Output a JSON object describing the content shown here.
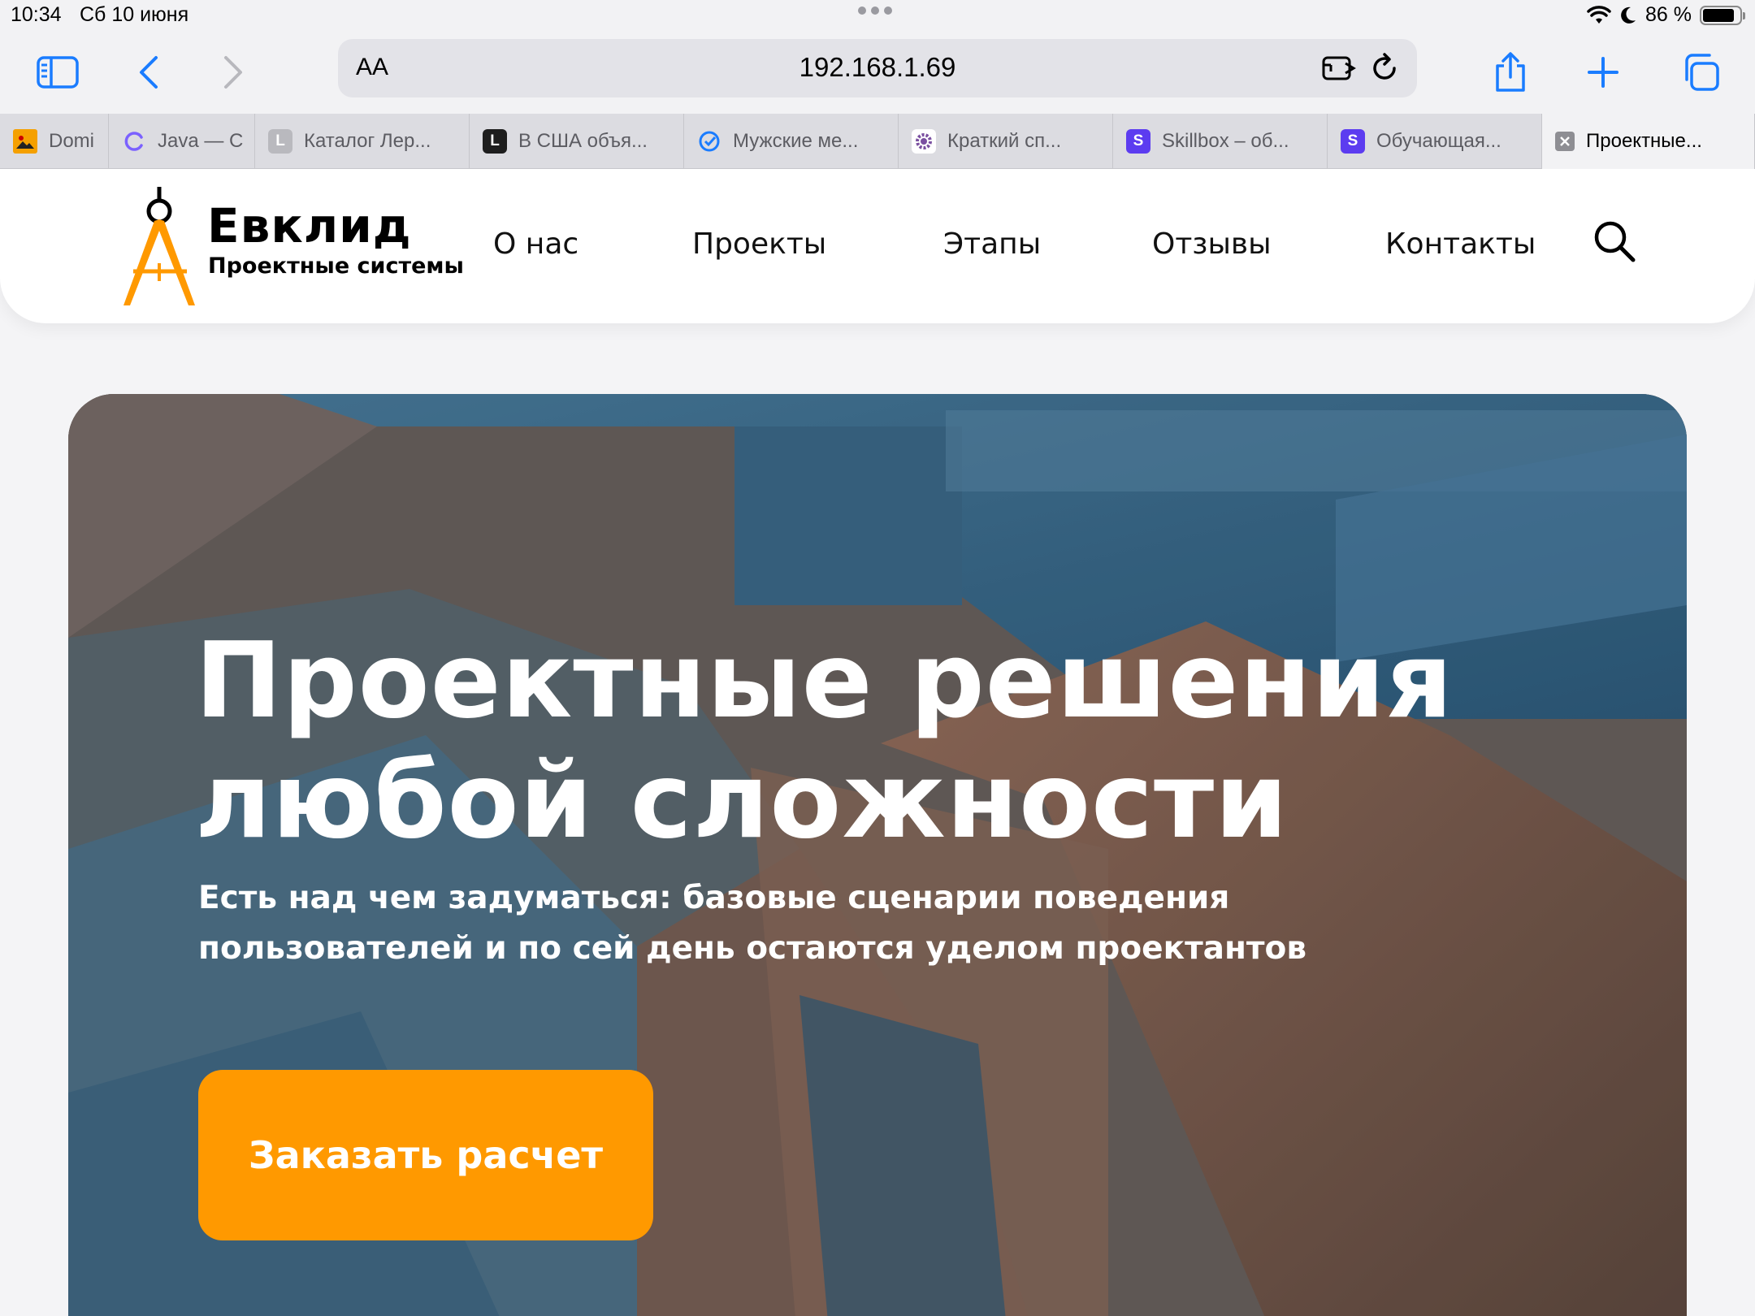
{
  "status_bar": {
    "time": "10:34",
    "date": "Сб 10 июня",
    "battery": "86 %",
    "battery_level": 0.86
  },
  "browser": {
    "text_size_label": "AA",
    "url": "192.168.1.69",
    "tabs": [
      {
        "title": "Domi",
        "favicon": "image-icon",
        "color": "#f5a000"
      },
      {
        "title": "Java — C",
        "favicon": "spinner-icon",
        "color": "#7b61ff"
      },
      {
        "title": "Каталог Лер...",
        "favicon": "L",
        "color": "#b9b9be"
      },
      {
        "title": "В США объя...",
        "favicon": "L",
        "color": "#1e1e1e"
      },
      {
        "title": "Мужские ме...",
        "favicon": "check-circle-icon",
        "color": "#1a7cff"
      },
      {
        "title": "Краткий сп...",
        "favicon": "gear-icon",
        "color": "#7a4fa0"
      },
      {
        "title": "Skillbox – об...",
        "favicon": "S",
        "color": "#5c3cf0"
      },
      {
        "title": "Обучающая...",
        "favicon": "S",
        "color": "#5c3cf0"
      },
      {
        "title": "Проектные...",
        "favicon": "close-icon",
        "color": "#8e8e93"
      }
    ]
  },
  "site": {
    "logo": {
      "name": "Евклид",
      "subtitle": "Проектные системы",
      "accent": "#ff9900"
    },
    "nav": [
      "О нас",
      "Проекты",
      "Этапы",
      "Отзывы",
      "Контакты"
    ],
    "hero": {
      "title_line1": "Проектные решения",
      "title_line2": "любой сложности",
      "subtitle": "Есть над чем задуматься: базовые сценарии поведения пользователей и по сей день остаются уделом проектантов",
      "cta": "Заказать расчет",
      "cta_color": "#ff9900"
    }
  }
}
